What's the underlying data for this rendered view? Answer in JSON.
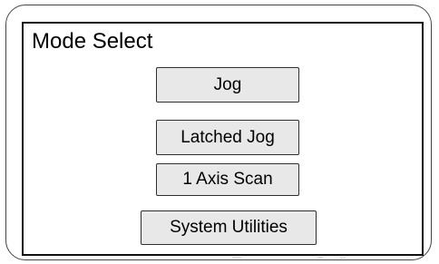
{
  "screen": {
    "title": "Mode Select"
  },
  "buttons": {
    "jog": "Jog",
    "latched_jog": "Latched Jog",
    "axis_scan": "1 Axis Scan",
    "system_utilities": "System Utilities"
  },
  "colors": {
    "button_fill": "#e8e8e8",
    "button_border": "#2f2f2f",
    "screen_border": "#111111",
    "bezel_border": "#444444"
  }
}
